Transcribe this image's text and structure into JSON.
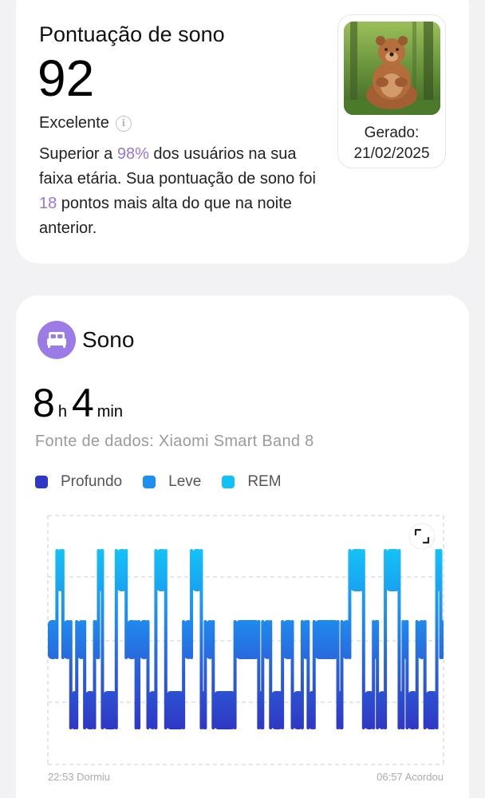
{
  "score_card": {
    "title": "Pontuação de sono",
    "score": "92",
    "grade": "Excelente",
    "desc_part1": "Superior a ",
    "percent": "98%",
    "desc_part2": " dos usuários na sua faixa etária. Sua pontuação de sono foi ",
    "points": "18",
    "desc_part3": " pontos mais alta do que na noite anterior.",
    "generated_label": "Gerado:",
    "generated_date": "21/02/2025",
    "highlight_color": "#9a74df"
  },
  "sleep_card": {
    "title": "Sono",
    "hours": "8",
    "hours_unit": "h",
    "minutes": "4",
    "minutes_unit": "min",
    "source": "Fonte de dados: Xiaomi Smart Band 8",
    "icon_color": "#9c7be6"
  },
  "chart_data": {
    "type": "area",
    "legend": [
      {
        "name": "Profundo",
        "color": "#2f37c4"
      },
      {
        "name": "Leve",
        "color": "#1e8ff0"
      },
      {
        "name": "REM",
        "color": "#14c1f5"
      }
    ],
    "start_label": "22:53 Dormiu",
    "end_label": "06:57 Acordou",
    "levels": [
      "Profundo",
      "Leve",
      "REM"
    ],
    "segments": [
      {
        "stage": "Leve",
        "start": 0.0,
        "end": 0.025
      },
      {
        "stage": "REM",
        "start": 0.025,
        "end": 0.04
      },
      {
        "stage": "Leve",
        "start": 0.04,
        "end": 0.06
      },
      {
        "stage": "Profundo",
        "start": 0.06,
        "end": 0.075
      },
      {
        "stage": "Leve",
        "start": 0.075,
        "end": 0.095
      },
      {
        "stage": "Profundo",
        "start": 0.095,
        "end": 0.12
      },
      {
        "stage": "Leve",
        "start": 0.12,
        "end": 0.13
      },
      {
        "stage": "REM",
        "start": 0.13,
        "end": 0.14
      },
      {
        "stage": "Profundo",
        "start": 0.14,
        "end": 0.175
      },
      {
        "stage": "REM",
        "start": 0.175,
        "end": 0.2
      },
      {
        "stage": "Leve",
        "start": 0.2,
        "end": 0.225
      },
      {
        "stage": "Profundo",
        "start": 0.225,
        "end": 0.232
      },
      {
        "stage": "Leve",
        "start": 0.232,
        "end": 0.255
      },
      {
        "stage": "Profundo",
        "start": 0.255,
        "end": 0.275
      },
      {
        "stage": "REM",
        "start": 0.275,
        "end": 0.3
      },
      {
        "stage": "Profundo",
        "start": 0.3,
        "end": 0.345
      },
      {
        "stage": "Leve",
        "start": 0.345,
        "end": 0.365
      },
      {
        "stage": "REM",
        "start": 0.365,
        "end": 0.39
      },
      {
        "stage": "Profundo",
        "start": 0.39,
        "end": 0.4
      },
      {
        "stage": "Leve",
        "start": 0.4,
        "end": 0.42
      },
      {
        "stage": "Profundo",
        "start": 0.42,
        "end": 0.475
      },
      {
        "stage": "Leve",
        "start": 0.475,
        "end": 0.535
      },
      {
        "stage": "Profundo",
        "start": 0.535,
        "end": 0.545
      },
      {
        "stage": "Leve",
        "start": 0.545,
        "end": 0.565
      },
      {
        "stage": "Profundo",
        "start": 0.565,
        "end": 0.595
      },
      {
        "stage": "Leve",
        "start": 0.595,
        "end": 0.62
      },
      {
        "stage": "Profundo",
        "start": 0.62,
        "end": 0.645
      },
      {
        "stage": "Leve",
        "start": 0.645,
        "end": 0.66
      },
      {
        "stage": "Profundo",
        "start": 0.66,
        "end": 0.675
      },
      {
        "stage": "Leve",
        "start": 0.675,
        "end": 0.735
      },
      {
        "stage": "Profundo",
        "start": 0.735,
        "end": 0.745
      },
      {
        "stage": "Leve",
        "start": 0.745,
        "end": 0.765
      },
      {
        "stage": "REM",
        "start": 0.765,
        "end": 0.8
      },
      {
        "stage": "Profundo",
        "start": 0.8,
        "end": 0.825
      },
      {
        "stage": "Leve",
        "start": 0.825,
        "end": 0.835
      },
      {
        "stage": "Profundo",
        "start": 0.835,
        "end": 0.855
      },
      {
        "stage": "REM",
        "start": 0.855,
        "end": 0.89
      },
      {
        "stage": "Profundo",
        "start": 0.89,
        "end": 0.9
      },
      {
        "stage": "Leve",
        "start": 0.9,
        "end": 0.91
      },
      {
        "stage": "Profundo",
        "start": 0.91,
        "end": 0.935
      },
      {
        "stage": "Leve",
        "start": 0.935,
        "end": 0.955
      },
      {
        "stage": "Profundo",
        "start": 0.955,
        "end": 0.985
      },
      {
        "stage": "REM",
        "start": 0.985,
        "end": 0.995
      },
      {
        "stage": "Leve",
        "start": 0.995,
        "end": 1.0
      }
    ],
    "grid": true,
    "legend_position": "top-left"
  }
}
